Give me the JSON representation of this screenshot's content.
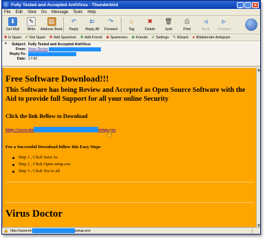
{
  "window": {
    "title": "Fully Tested and Accepted AntiVirus - Thunderbird"
  },
  "menu": [
    "File",
    "Edit",
    "View",
    "Go",
    "Message",
    "Tools",
    "Help"
  ],
  "toolbar": {
    "get_mail": "Get Mail",
    "write": "Write",
    "address_book": "Address Book",
    "reply": "Reply",
    "reply_all": "Reply All",
    "forward": "Forward",
    "tag": "Tag",
    "delete": "Delete",
    "junk": "Junk",
    "print": "Print",
    "back": "Back",
    "forward_nav": "Forward"
  },
  "spambar": [
    "Is Spam",
    "Not Spam",
    "Add Spammer",
    "Add Friend",
    "Spammers",
    "Friends",
    "Settings",
    "Wizard",
    "Bitdefender Antispam"
  ],
  "headers": {
    "subject_label": "Subject:",
    "subject": "Fully Tested and Accepted AntiVirus",
    "from_label": "From:",
    "from": "Virus Doctor",
    "replyto_label": "Reply-To:",
    "date_label": "Date:",
    "date": "17:42"
  },
  "body": {
    "heading": "Free Software Download!!!",
    "subheading": "This Software has being Review and Accepted as Open Source Software with the Aid to provide full Support for all your online Security",
    "click_link": "Click the link Bellow to Download",
    "link_prefix": "http://www.tm",
    "link_suffix": "setup.exe",
    "steps_heading": "For a Successful Download follow this Easy Steps",
    "steps": [
      "Step 1 , Click Save As",
      "Step 2 , Click Open setup.exe",
      "Step 3 , Click Yes to all"
    ],
    "signature": "Virus Doctor"
  },
  "statusbar": {
    "url_prefix": "http://www.tm",
    "url_suffix": "setup.exe"
  },
  "colors": {
    "body_bg": "#ffa500",
    "redaction": "#1e90ff",
    "titlebar": "#0a3fb0"
  }
}
